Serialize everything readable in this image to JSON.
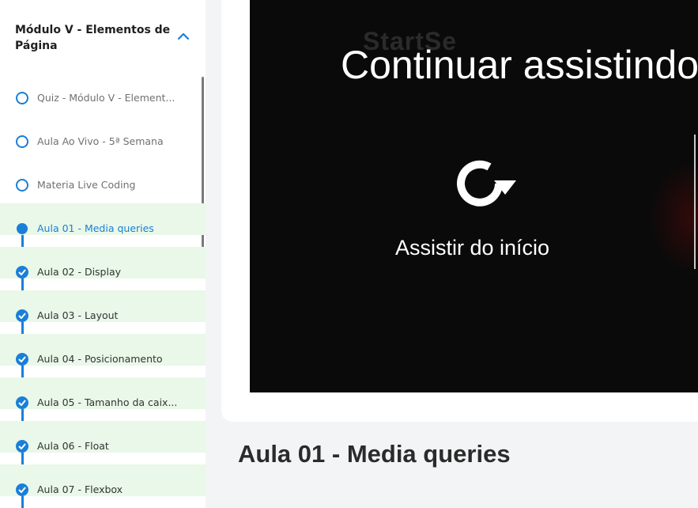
{
  "module": {
    "title": "Módulo V - Elementos de Página"
  },
  "lessons": [
    {
      "label": "Quiz - Módulo V - Element...",
      "status": "open"
    },
    {
      "label": "Aula Ao Vivo - 5ª Semana",
      "status": "open"
    },
    {
      "label": "Materia Live Coding",
      "status": "open"
    },
    {
      "label": "Aula 01 - Media queries",
      "status": "current"
    },
    {
      "label": "Aula 02 - Display",
      "status": "done"
    },
    {
      "label": "Aula 03 - Layout",
      "status": "done"
    },
    {
      "label": "Aula 04 - Posicionamento",
      "status": "done"
    },
    {
      "label": "Aula 05 - Tamanho da caix...",
      "status": "done"
    },
    {
      "label": "Aula 06 - Float",
      "status": "done"
    },
    {
      "label": "Aula 07 - Flexbox",
      "status": "done"
    }
  ],
  "player": {
    "watermark": "StartSe",
    "continue_text": "Continuar assistindo",
    "restart_text": "Assistir do início"
  },
  "lesson_title": "Aula 01 - Media queries",
  "colors": {
    "accent": "#1a7fd8",
    "done_bg": "#e9f8e8"
  }
}
